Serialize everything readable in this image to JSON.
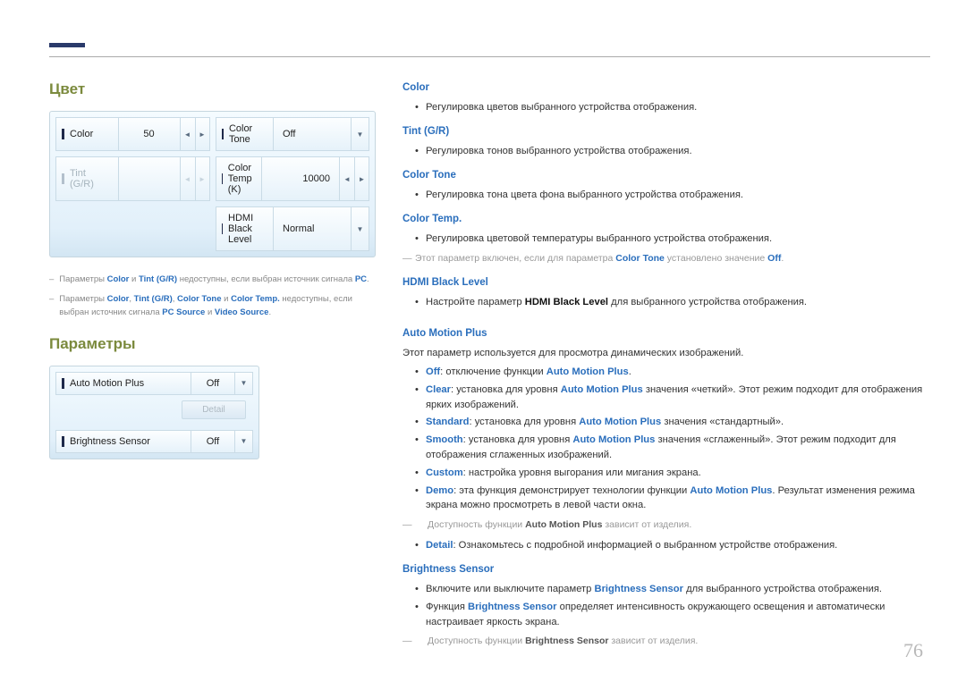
{
  "page_number": "76",
  "left": {
    "section1_title": "Цвет",
    "panel1": {
      "color_label": "Color",
      "color_value": "50",
      "tint_label": "Tint (G/R)",
      "colortone_label": "Color Tone",
      "colortone_value": "Off",
      "colortemp_label": "Color Temp (K)",
      "colortemp_value": "10000",
      "hdmibl_label": "HDMI Black Level",
      "hdmibl_value": "Normal"
    },
    "footnote1_pre": "Параметры ",
    "footnote1_b1": "Color",
    "footnote1_mid1": " и ",
    "footnote1_b2": "Tint (G/R)",
    "footnote1_mid2": " недоступны, если выбран источник сигнала ",
    "footnote1_b3": "PC",
    "footnote1_end": ".",
    "footnote2_pre": "Параметры ",
    "footnote2_b1": "Color",
    "footnote2_c1": ", ",
    "footnote2_b2": "Tint (G/R)",
    "footnote2_c2": ", ",
    "footnote2_b3": "Color Tone",
    "footnote2_c3": " и ",
    "footnote2_b4": "Color Temp.",
    "footnote2_mid": " недоступны, если выбран источник сигнала ",
    "footnote2_b5": "PC Source",
    "footnote2_c4": " и ",
    "footnote2_b6": "Video Source",
    "footnote2_end": ".",
    "section2_title": "Параметры",
    "panel2": {
      "amp_label": "Auto Motion Plus",
      "amp_value": "Off",
      "detail_label": "Detail",
      "bs_label": "Brightness Sensor",
      "bs_value": "Off"
    }
  },
  "right": {
    "color_h": "Color",
    "color_b1": "Регулировка цветов выбранного устройства отображения.",
    "tint_h": "Tint (G/R)",
    "tint_b1": "Регулировка тонов выбранного устройства отображения.",
    "ctone_h": "Color Tone",
    "ctone_b1": "Регулировка тона цвета фона выбранного устройства отображения.",
    "ctemp_h": "Color Temp.",
    "ctemp_b1": "Регулировка цветовой температуры выбранного устройства отображения.",
    "ctemp_dash_pre": "Этот параметр включен, если для параметра ",
    "ctemp_dash_b1": "Color Tone",
    "ctemp_dash_mid": " установлено значение ",
    "ctemp_dash_b2": "Off",
    "ctemp_dash_end": ".",
    "hdmibl_h": "HDMI Black Level",
    "hdmibl_b1_pre": "Настройте параметр ",
    "hdmibl_b1_b": "HDMI Black Level",
    "hdmibl_b1_post": " для выбранного устройства отображения.",
    "amp_h": "Auto Motion Plus",
    "amp_para": "Этот параметр используется для просмотра динамических изображений.",
    "amp_off_b": "Off",
    "amp_off_rest": ": отключение функции ",
    "amp_off_b2": "Auto Motion Plus",
    "amp_off_end": ".",
    "amp_clear_b": "Clear",
    "amp_clear_rest1": ": установка для уровня ",
    "amp_clear_b2": "Auto Motion Plus",
    "amp_clear_rest2": " значения «четкий». Этот режим подходит для отображения ярких изображений.",
    "amp_std_b": "Standard",
    "amp_std_rest1": ": установка для уровня ",
    "amp_std_b2": "Auto Motion Plus",
    "amp_std_rest2": " значения «стандартный».",
    "amp_smooth_b": "Smooth",
    "amp_smooth_rest1": ": установка для уровня ",
    "amp_smooth_b2": "Auto Motion Plus",
    "amp_smooth_rest2": " значения «сглаженный». Этот режим подходит для отображения сглаженных изображений.",
    "amp_custom_b": "Custom",
    "amp_custom_rest": ": настройка уровня выгорания или мигания экрана.",
    "amp_demo_b": "Demo",
    "amp_demo_rest1": ": эта функция демонстрирует технологии функции ",
    "amp_demo_b2": "Auto Motion Plus",
    "amp_demo_rest2": ". Результат изменения режима экрана можно просмотреть в левой части окна.",
    "amp_dash_pre": "Доступность функции ",
    "amp_dash_b": "Auto Motion Plus",
    "amp_dash_post": " зависит от изделия.",
    "amp_detail_b": "Detail",
    "amp_detail_rest": ": Ознакомьтесь с подробной информацией о выбранном устройстве отображения.",
    "bs_h": "Brightness Sensor",
    "bs_b1_pre": "Включите или выключите параметр ",
    "bs_b1_b": "Brightness Sensor",
    "bs_b1_post": " для выбранного устройства отображения.",
    "bs_b2_pre": "Функция ",
    "bs_b2_b": "Brightness Sensor",
    "bs_b2_post": " определяет интенсивность окружающего освещения и автоматически настраивает яркость экрана.",
    "bs_dash_pre": "Доступность функции ",
    "bs_dash_b": "Brightness Sensor",
    "bs_dash_post": " зависит от изделия."
  }
}
